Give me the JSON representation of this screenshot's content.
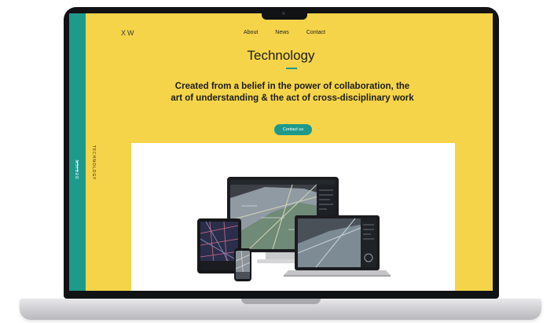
{
  "site": {
    "logo": "XW",
    "nav": [
      {
        "label": "About"
      },
      {
        "label": "News"
      },
      {
        "label": "Contact"
      }
    ],
    "side_rail_label": "DESIGN",
    "vertical_tab_label": "TECHNOLOGY"
  },
  "hero": {
    "title": "Technology",
    "headline": "Created from a belief in the power of collaboration, the art of understanding & the act of cross-disciplinary work",
    "cta_label": "Contact us"
  },
  "colors": {
    "background": "#f5d449",
    "accent": "#1e9a8c",
    "text": "#1c1c1c",
    "device_frame": "#111214"
  },
  "icons": {
    "devices_illustration": "multi-device-mockup"
  }
}
